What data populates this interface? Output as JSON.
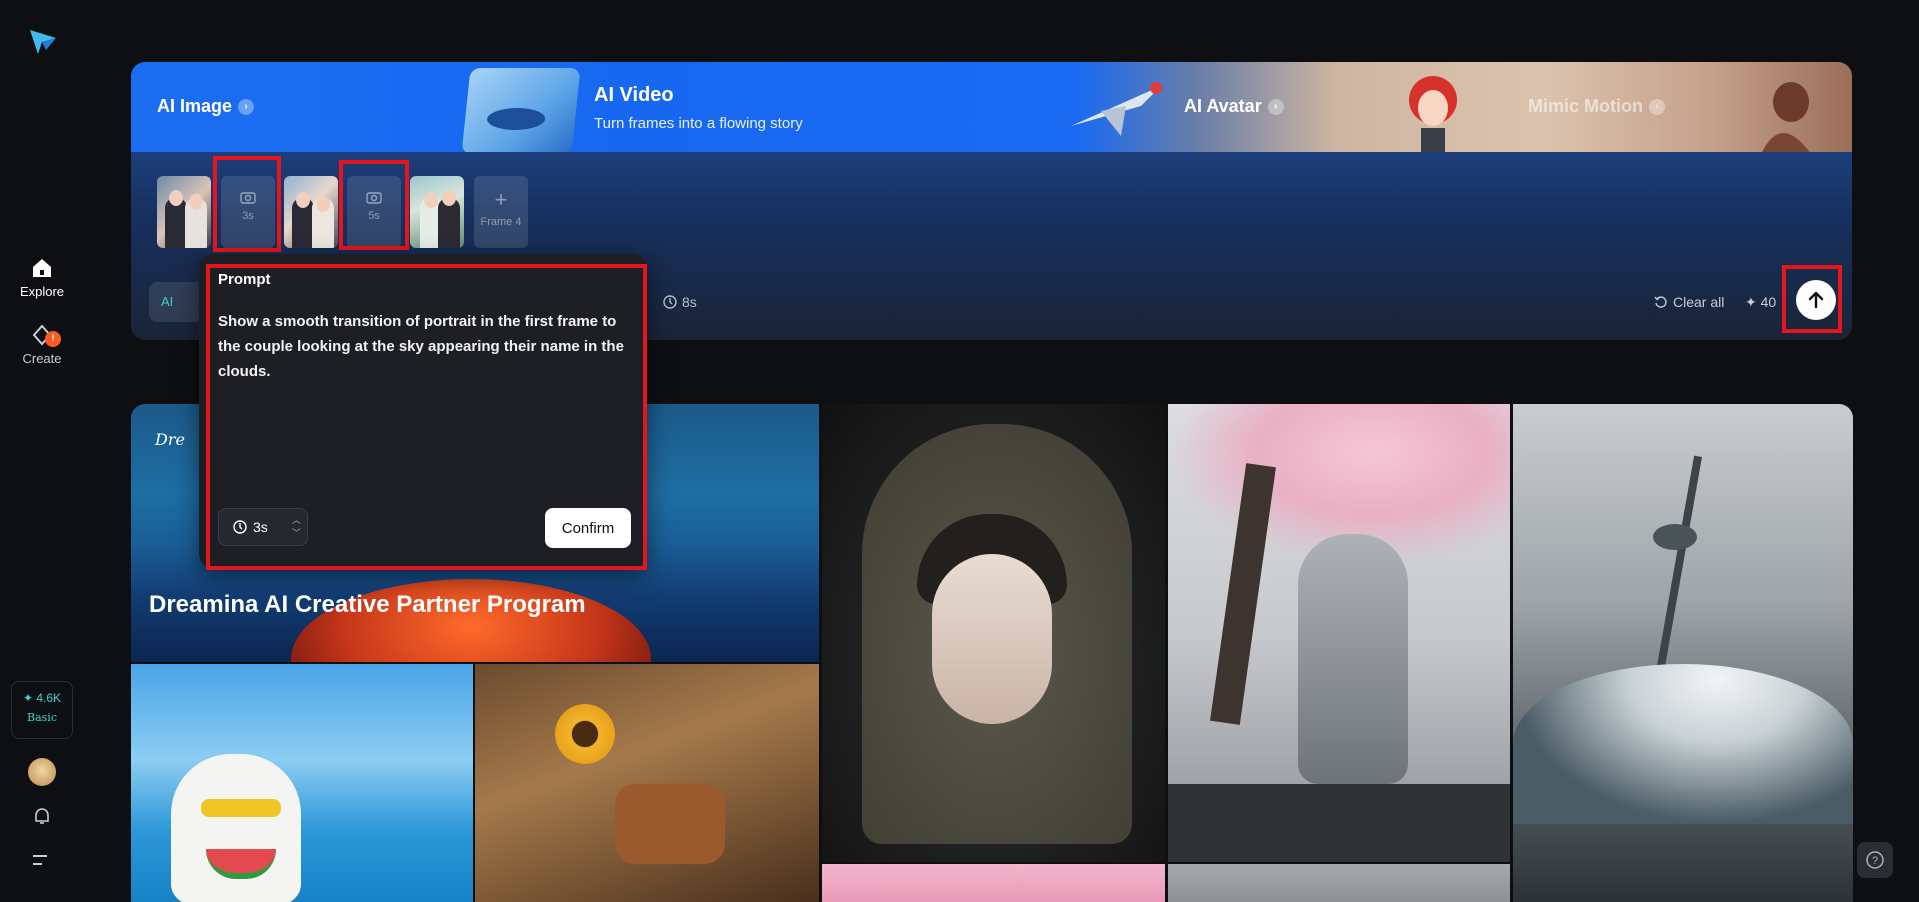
{
  "sidebar": {
    "nav": [
      {
        "label": "Explore",
        "icon": "home-icon"
      },
      {
        "label": "Create",
        "icon": "create-icon",
        "badge": "!"
      }
    ],
    "credits": {
      "amount": "✦ 4.6K",
      "plan": "Basic"
    }
  },
  "banner": {
    "tabs": {
      "ai_image": "AI Image",
      "ai_video_title": "AI Video",
      "ai_video_subtitle": "Turn frames into a flowing story",
      "ai_avatar": "AI Avatar",
      "mimic_motion": "Mimic Motion"
    },
    "thumb_logo": "Dreamina"
  },
  "frames_panel": {
    "gap1_duration": "3s",
    "gap2_duration": "5s",
    "add_frame_label": "Frame 4",
    "mode_label": "AI",
    "total_duration": "8s",
    "clear_all": "Clear all",
    "cost": "✦ 40"
  },
  "prompt_popup": {
    "title": "Prompt",
    "text": "Show a smooth transition of portrait in the first frame to the couple looking at the sky appearing their name in the clouds.",
    "duration": "3s",
    "confirm": "Confirm"
  },
  "gallery": {
    "promo_logo": "Dre",
    "promo_title": "Dreamina AI Creative Partner Program"
  },
  "colors": {
    "accent_teal": "#41d6d1",
    "highlight_red": "#e3161e",
    "badge_orange": "#ff5a1f"
  }
}
